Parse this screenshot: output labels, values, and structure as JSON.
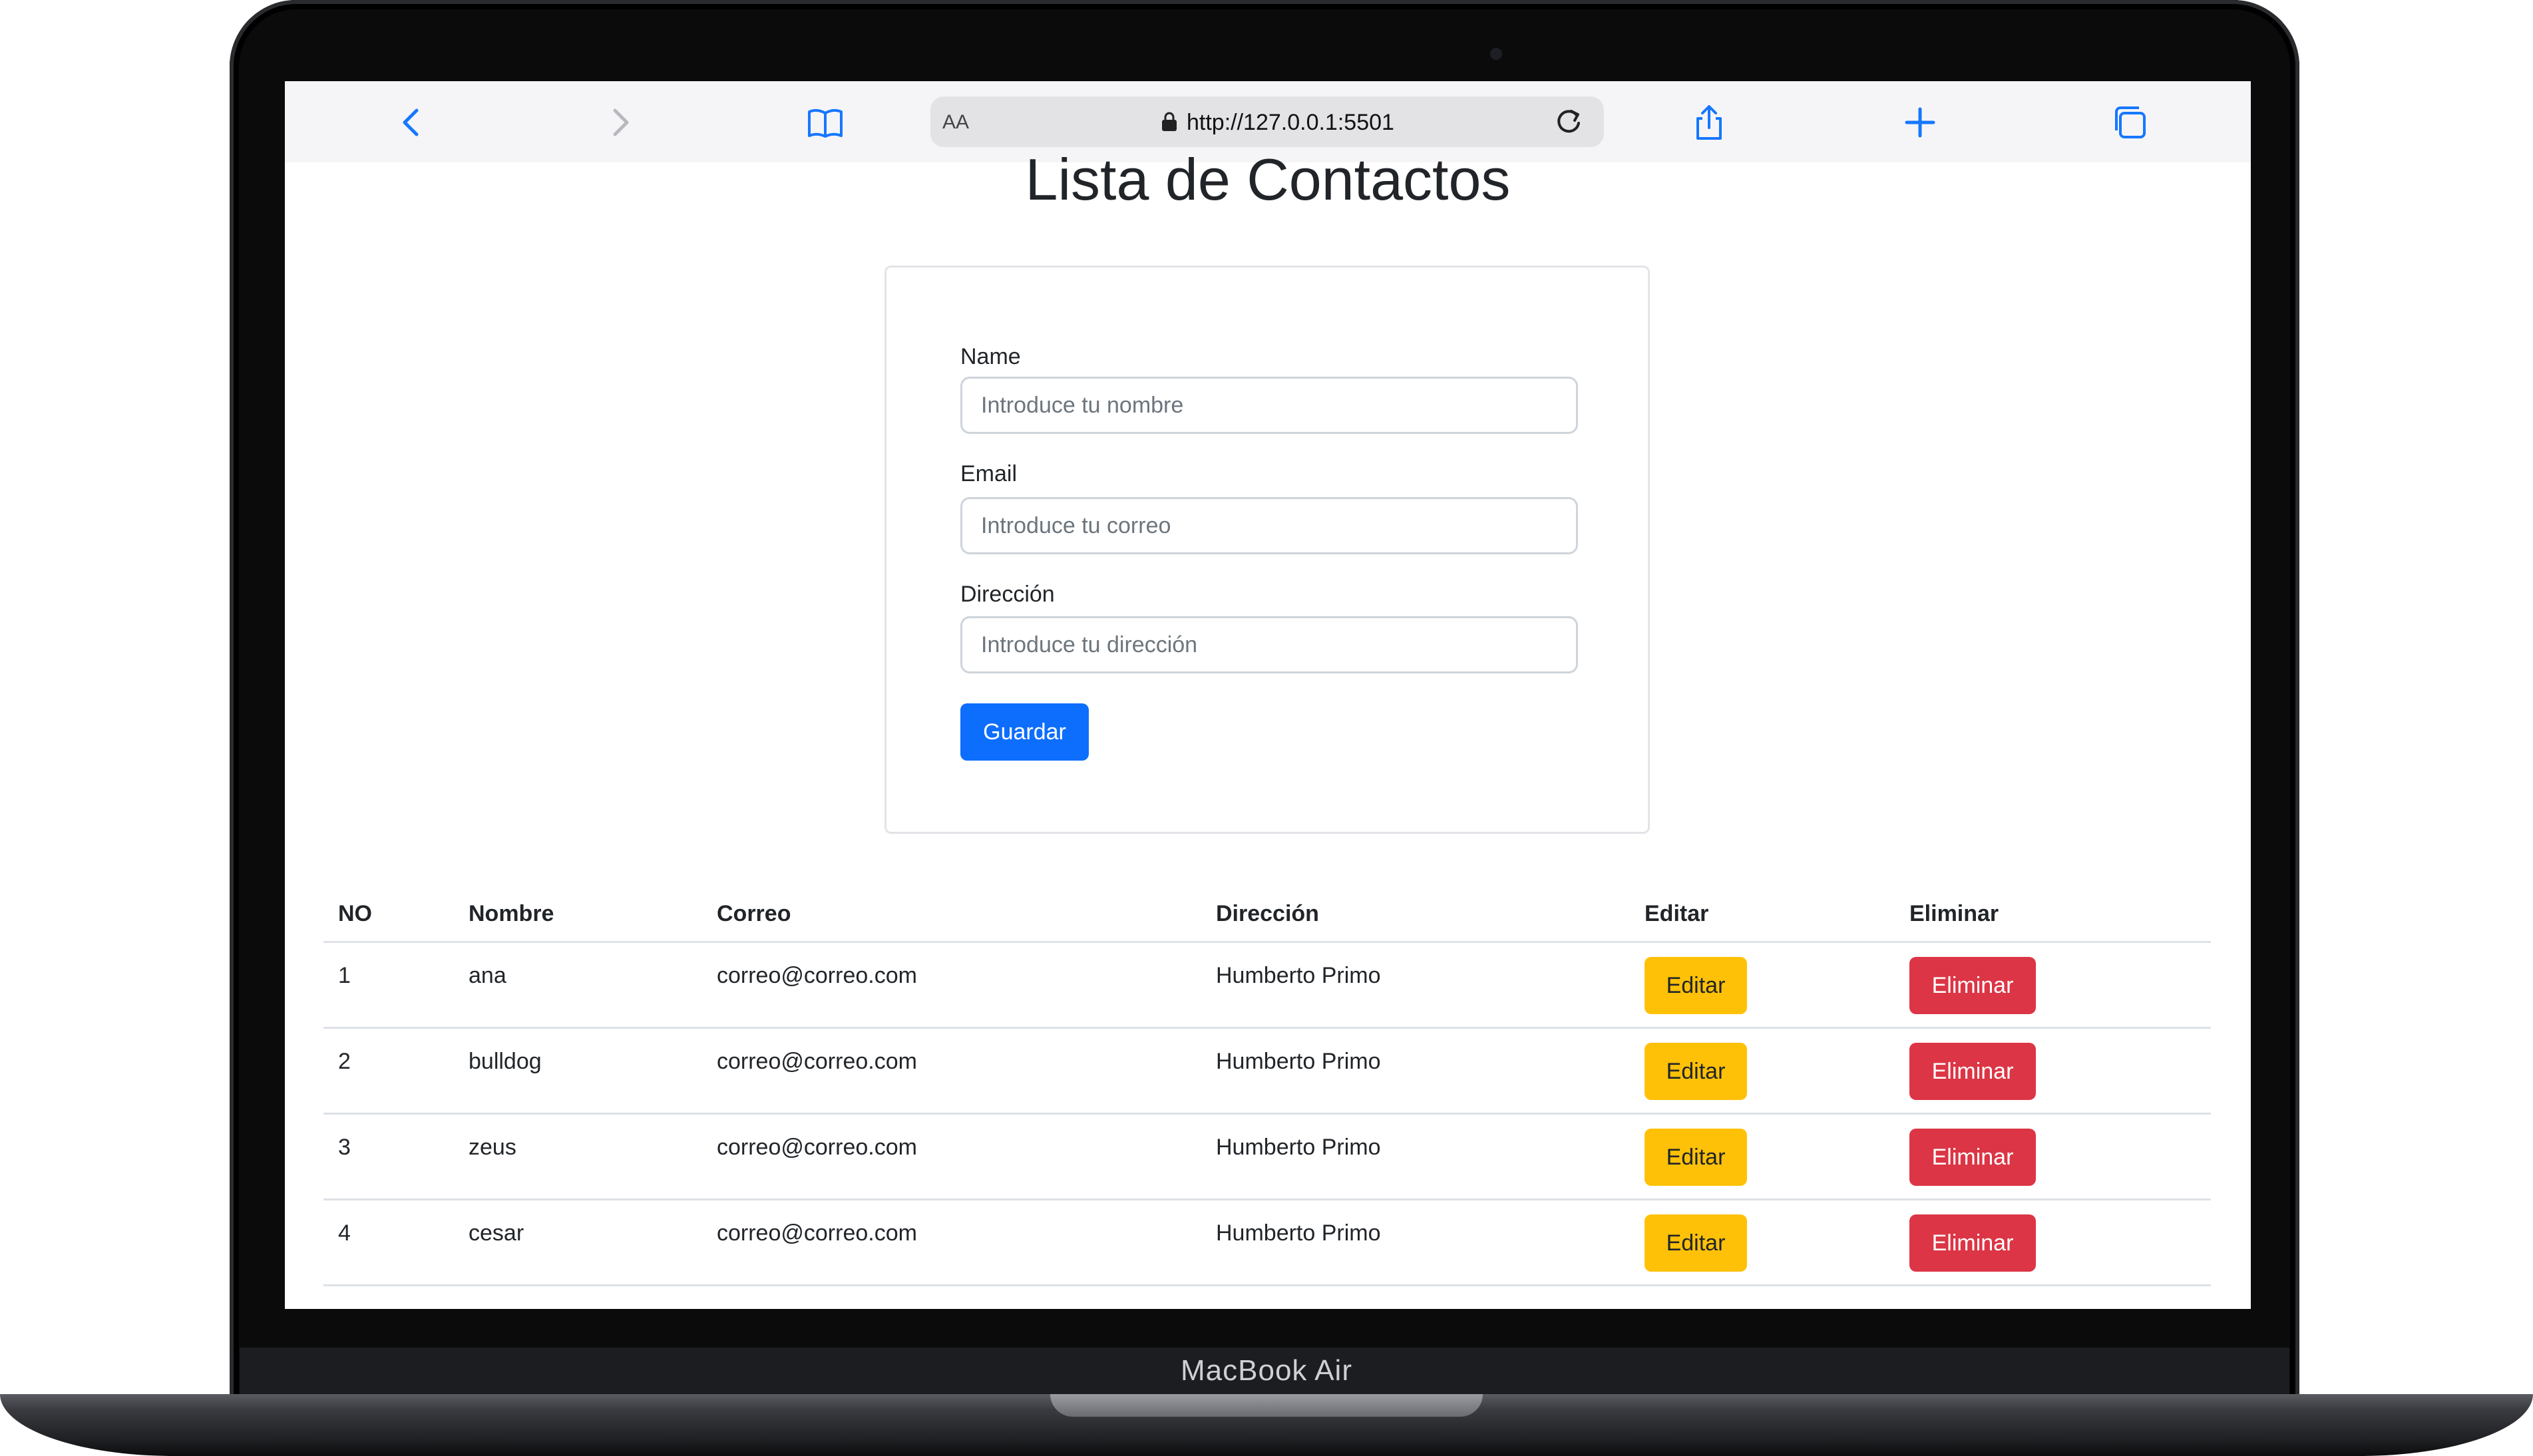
{
  "device": {
    "label": "MacBook Air"
  },
  "browser": {
    "text_size_label": "AA",
    "url": "http://127.0.0.1:5501"
  },
  "page": {
    "title": "Lista de Contactos"
  },
  "form": {
    "name_label": "Name",
    "name_placeholder": "Introduce tu nombre",
    "email_label": "Email",
    "email_placeholder": "Introduce tu correo",
    "address_label": "Dirección",
    "address_placeholder": "Introduce tu dirección",
    "submit_label": "Guardar"
  },
  "table": {
    "headers": [
      "NO",
      "Nombre",
      "Correo",
      "Dirección",
      "Editar",
      "Eliminar"
    ],
    "rows": [
      {
        "no": "1",
        "nombre": "ana",
        "correo": "correo@correo.com",
        "direccion": "Humberto Primo",
        "edit": "Editar",
        "delete": "Eliminar"
      },
      {
        "no": "2",
        "nombre": "bulldog",
        "correo": "correo@correo.com",
        "direccion": "Humberto Primo",
        "edit": "Editar",
        "delete": "Eliminar"
      },
      {
        "no": "3",
        "nombre": "zeus",
        "correo": "correo@correo.com",
        "direccion": "Humberto Primo",
        "edit": "Editar",
        "delete": "Eliminar"
      },
      {
        "no": "4",
        "nombre": "cesar",
        "correo": "correo@correo.com",
        "direccion": "Humberto Primo",
        "edit": "Editar",
        "delete": "Eliminar"
      }
    ]
  },
  "colors": {
    "primary": "#0d6efd",
    "warning": "#ffc107",
    "danger": "#dc3545",
    "browser_accent": "#1677ff"
  },
  "icons": [
    "back-icon",
    "forward-icon",
    "bookmarks-icon",
    "lock-icon",
    "reload-icon",
    "share-icon",
    "new-tab-icon",
    "tabs-icon"
  ]
}
